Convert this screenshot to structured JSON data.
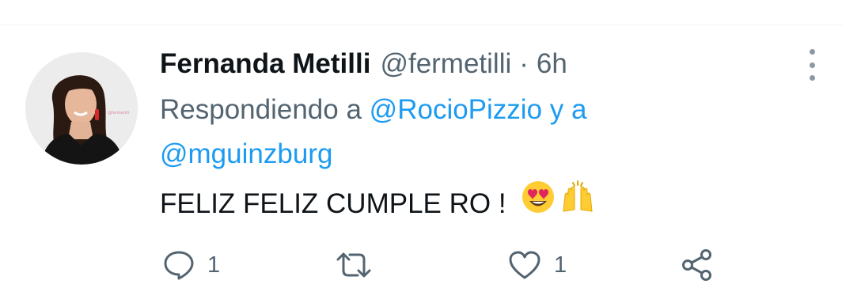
{
  "tweet": {
    "author_name": "Fernanda Metilli",
    "handle": "@fermetilli",
    "separator": "·",
    "time": "6h",
    "reply_prefix": "Respondiendo a",
    "reply_user1": "@RocioPizzio",
    "reply_conjunction": "y a",
    "reply_user2": "@mguinzburg",
    "text": "FELIZ FELIZ CUMPLE RO !",
    "emojis": [
      "heart-eyes-emoji",
      "raising-hands-emoji"
    ]
  },
  "actions": {
    "reply_count": "1",
    "retweet_count": "",
    "like_count": "1"
  },
  "colors": {
    "text_primary": "#0f1419",
    "text_secondary": "#536471",
    "link": "#1d9bf0",
    "divider": "#eff3f4"
  }
}
